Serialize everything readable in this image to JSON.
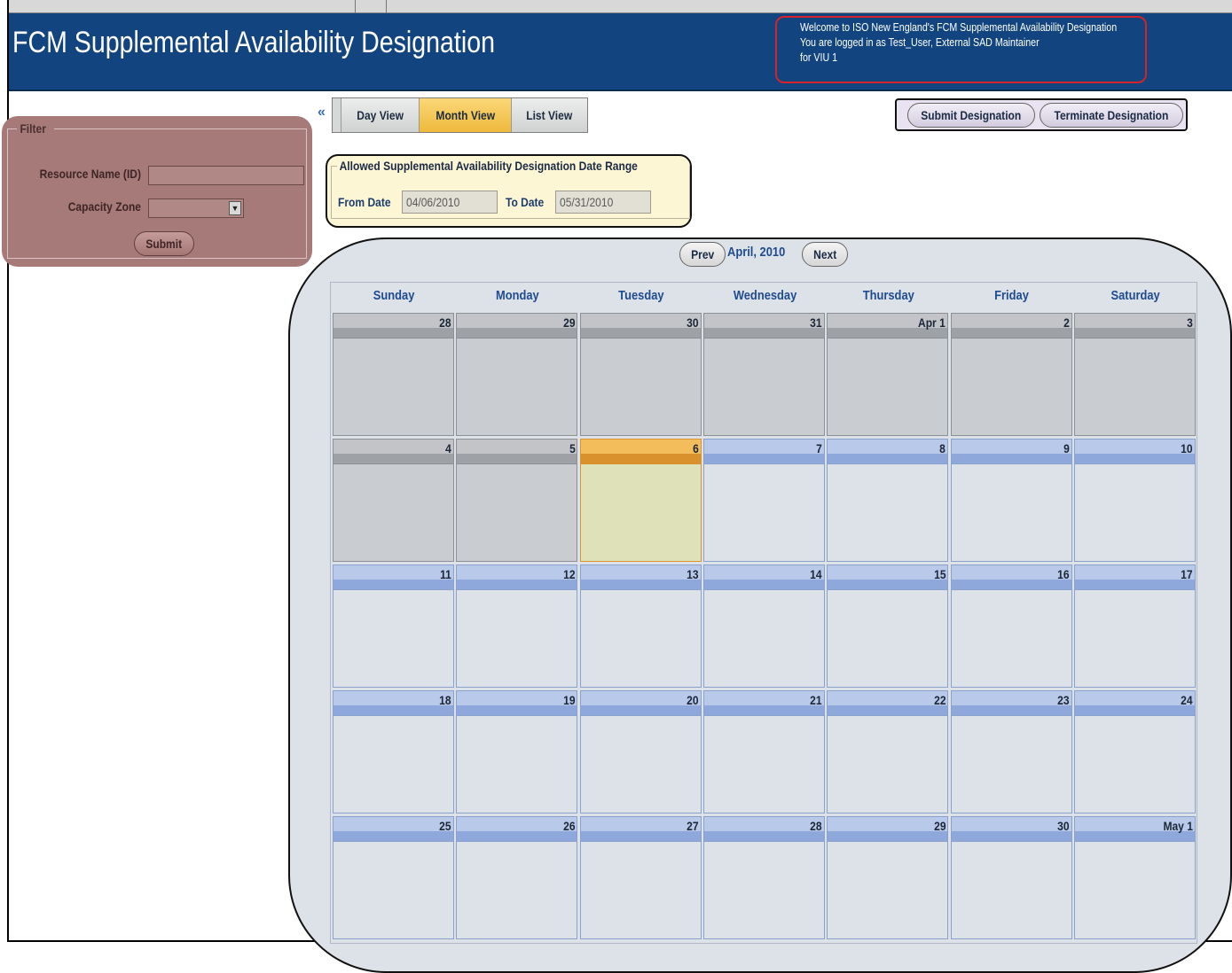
{
  "app": {
    "title": "FCM Supplemental Availability Designation",
    "welcome_line1": "Welcome to ISO New England's FCM Supplemental Availability Designation",
    "welcome_line2": "You are logged in as Test_User, External SAD Maintainer",
    "welcome_line3": "for VIU 1"
  },
  "filter": {
    "legend": "Filter",
    "resource_label": "Resource Name (ID)",
    "resource_value": "",
    "zone_label": "Capacity Zone",
    "zone_value": "",
    "submit_label": "Submit",
    "collapse_glyph": "«"
  },
  "views": {
    "day": "Day View",
    "month": "Month View",
    "list": "List View",
    "active": "Month View"
  },
  "actions": {
    "submit": "Submit Designation",
    "terminate": "Terminate Designation"
  },
  "date_range": {
    "legend": "Allowed Supplemental Availability Designation Date Range",
    "from_label": "From Date",
    "from_value": "04/06/2010",
    "to_label": "To Date",
    "to_value": "05/31/2010"
  },
  "calendar": {
    "prev": "Prev",
    "month_label": "April, 2010",
    "next": "Next",
    "weekdays": [
      "Sunday",
      "Monday",
      "Tuesday",
      "Wednesday",
      "Thursday",
      "Friday",
      "Saturday"
    ],
    "weeks": [
      [
        {
          "label": "28",
          "state": "outside"
        },
        {
          "label": "29",
          "state": "outside"
        },
        {
          "label": "30",
          "state": "outside"
        },
        {
          "label": "31",
          "state": "outside"
        },
        {
          "label": "Apr 1",
          "state": "outside"
        },
        {
          "label": "2",
          "state": "outside"
        },
        {
          "label": "3",
          "state": "outside"
        }
      ],
      [
        {
          "label": "4",
          "state": "outside"
        },
        {
          "label": "5",
          "state": "outside"
        },
        {
          "label": "6",
          "state": "today"
        },
        {
          "label": "7",
          "state": "inrange"
        },
        {
          "label": "8",
          "state": "inrange"
        },
        {
          "label": "9",
          "state": "inrange"
        },
        {
          "label": "10",
          "state": "inrange"
        }
      ],
      [
        {
          "label": "11",
          "state": "inrange"
        },
        {
          "label": "12",
          "state": "inrange"
        },
        {
          "label": "13",
          "state": "inrange"
        },
        {
          "label": "14",
          "state": "inrange"
        },
        {
          "label": "15",
          "state": "inrange"
        },
        {
          "label": "16",
          "state": "inrange"
        },
        {
          "label": "17",
          "state": "inrange"
        }
      ],
      [
        {
          "label": "18",
          "state": "inrange"
        },
        {
          "label": "19",
          "state": "inrange"
        },
        {
          "label": "20",
          "state": "inrange"
        },
        {
          "label": "21",
          "state": "inrange"
        },
        {
          "label": "22",
          "state": "inrange"
        },
        {
          "label": "23",
          "state": "inrange"
        },
        {
          "label": "24",
          "state": "inrange"
        }
      ],
      [
        {
          "label": "25",
          "state": "inrange"
        },
        {
          "label": "26",
          "state": "inrange"
        },
        {
          "label": "27",
          "state": "inrange"
        },
        {
          "label": "28",
          "state": "inrange"
        },
        {
          "label": "29",
          "state": "inrange"
        },
        {
          "label": "30",
          "state": "inrange"
        },
        {
          "label": "May 1",
          "state": "inrange"
        }
      ]
    ]
  },
  "colors": {
    "header_bg": "#12457f",
    "welcome_border": "#d4232a",
    "filter_bg": "#a67a78",
    "active_tab": "#eeb93c",
    "date_range_bg": "#fdf6d5",
    "today_cell": "#dfe1b9",
    "inrange_header": "#8ea8dc",
    "outside_cell": "#c9ccd1"
  }
}
